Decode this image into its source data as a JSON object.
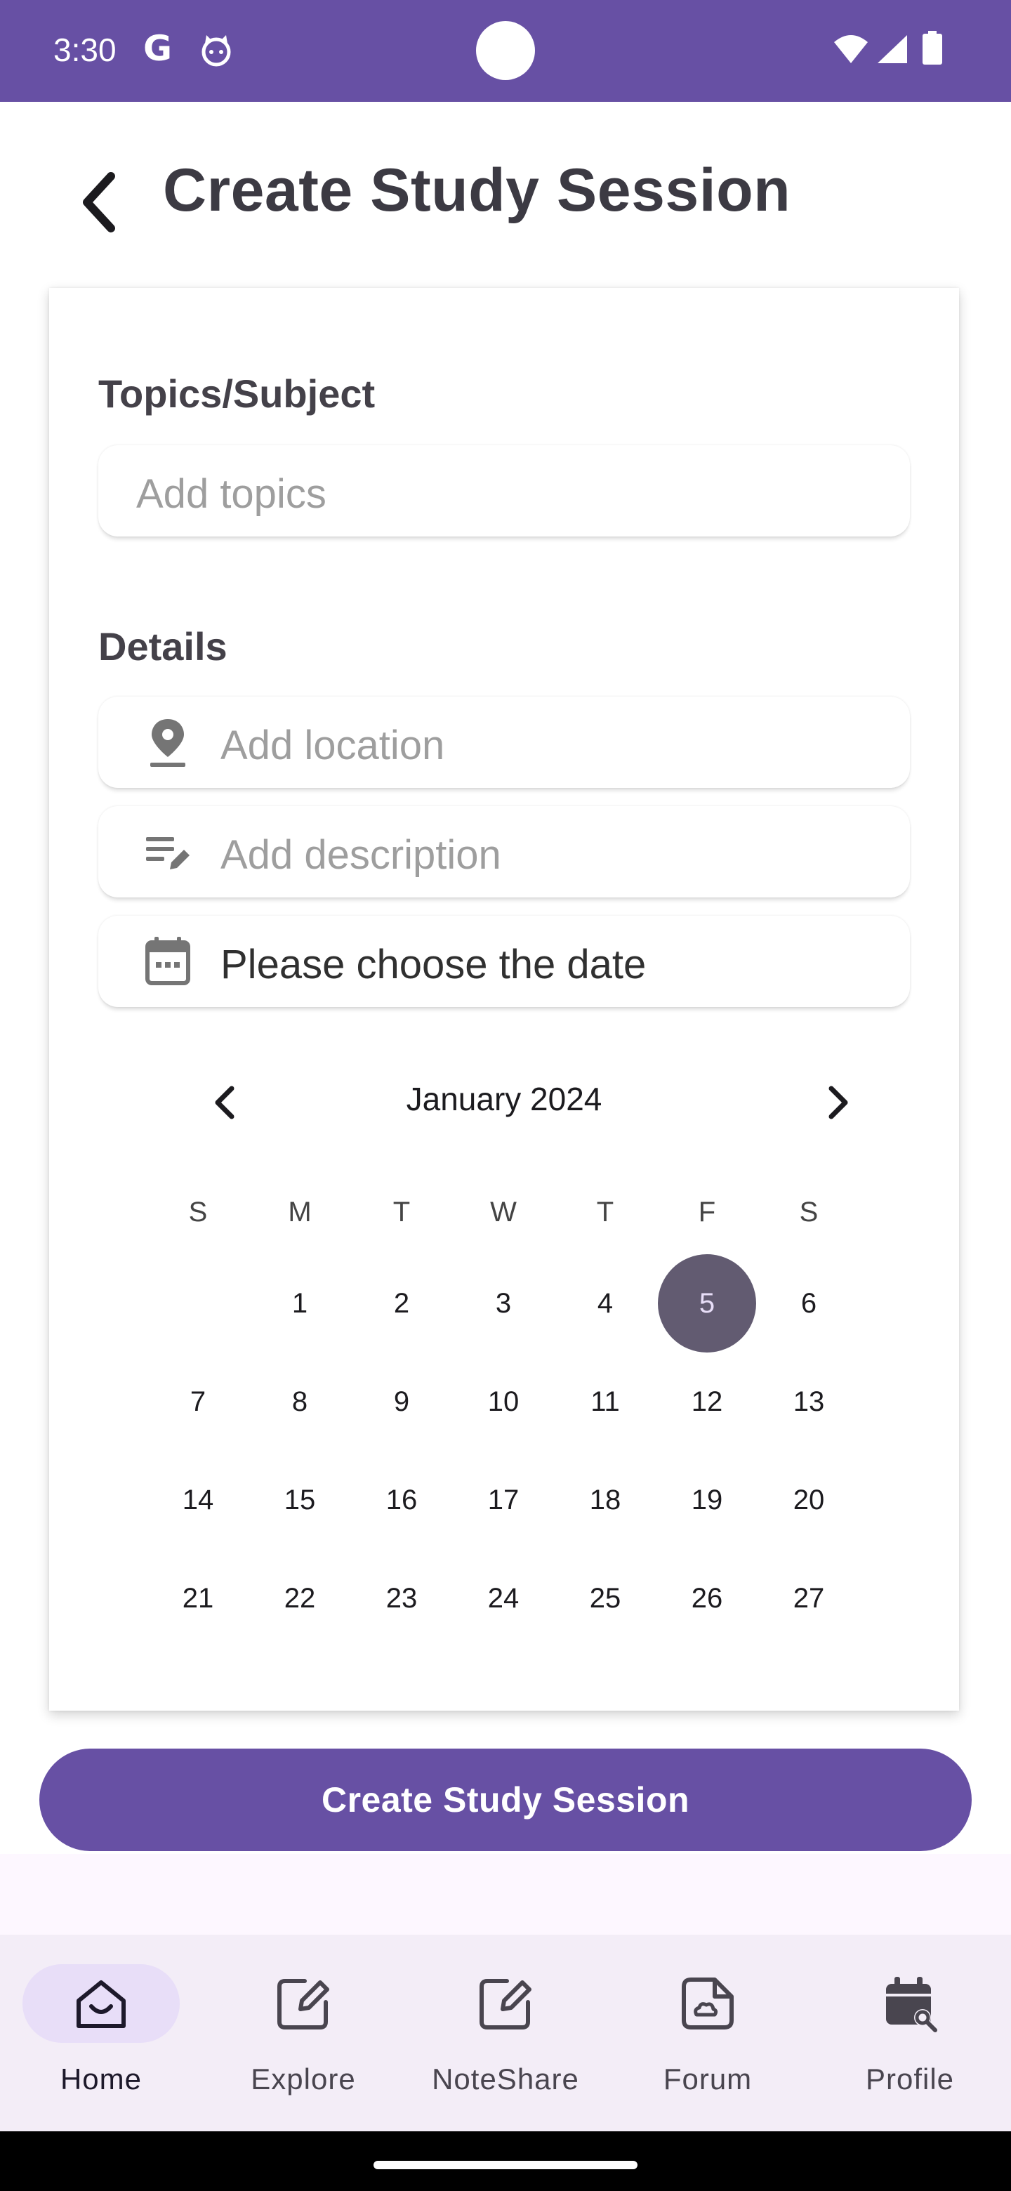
{
  "status_bar": {
    "time": "3:30",
    "google_letter": "G"
  },
  "header": {
    "title": "Create Study Session"
  },
  "form": {
    "topics_label": "Topics/Subject",
    "topics_placeholder": "Add topics",
    "details_label": "Details",
    "location_placeholder": "Add location",
    "description_placeholder": "Add description",
    "date_value": "Please choose the date"
  },
  "calendar": {
    "month": "January 2024",
    "weekdays": [
      "S",
      "M",
      "T",
      "W",
      "T",
      "F",
      "S"
    ],
    "first_weekday_index": 1,
    "days": [
      "1",
      "2",
      "3",
      "4",
      "5",
      "6",
      "7",
      "8",
      "9",
      "10",
      "11",
      "12",
      "13",
      "14",
      "15",
      "16",
      "17",
      "18",
      "19",
      "20",
      "21",
      "22",
      "23",
      "24",
      "25",
      "26",
      "27"
    ],
    "selected_day": "5"
  },
  "primary_button": {
    "label": "Create Study Session"
  },
  "nav": {
    "items": [
      {
        "label": "Home",
        "icon": "home-smile-icon",
        "active": true
      },
      {
        "label": "Explore",
        "icon": "edit-square-icon",
        "active": false
      },
      {
        "label": "NoteShare",
        "icon": "edit-square-icon",
        "active": false
      },
      {
        "label": "Forum",
        "icon": "note-cloud-icon",
        "active": false
      },
      {
        "label": "Profile",
        "icon": "calendar-search-icon",
        "active": false
      }
    ]
  },
  "colors": {
    "primary": "#6750a4",
    "selected_day_bg": "#625b71",
    "nav_bg": "#f3edf7",
    "nav_active_pill": "#e8def8"
  }
}
